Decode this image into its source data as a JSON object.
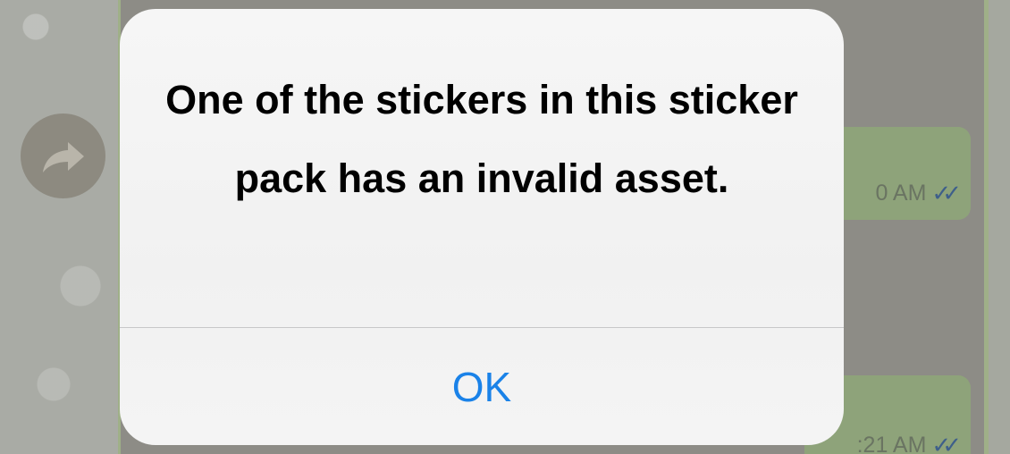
{
  "alert": {
    "message": "One of the stickers in this sticker pack has an invalid asset.",
    "ok_label": "OK"
  },
  "chat": {
    "messages": [
      {
        "time": "0 AM"
      },
      {
        "time": ":21 AM"
      }
    ]
  },
  "icons": {
    "forward": "forward-arrow-icon",
    "read_receipt": "double-check-icon"
  },
  "colors": {
    "ok_blue": "#1a82e8",
    "alert_bg": "#f4f4f4",
    "read_tick": "#3e5f8a"
  }
}
